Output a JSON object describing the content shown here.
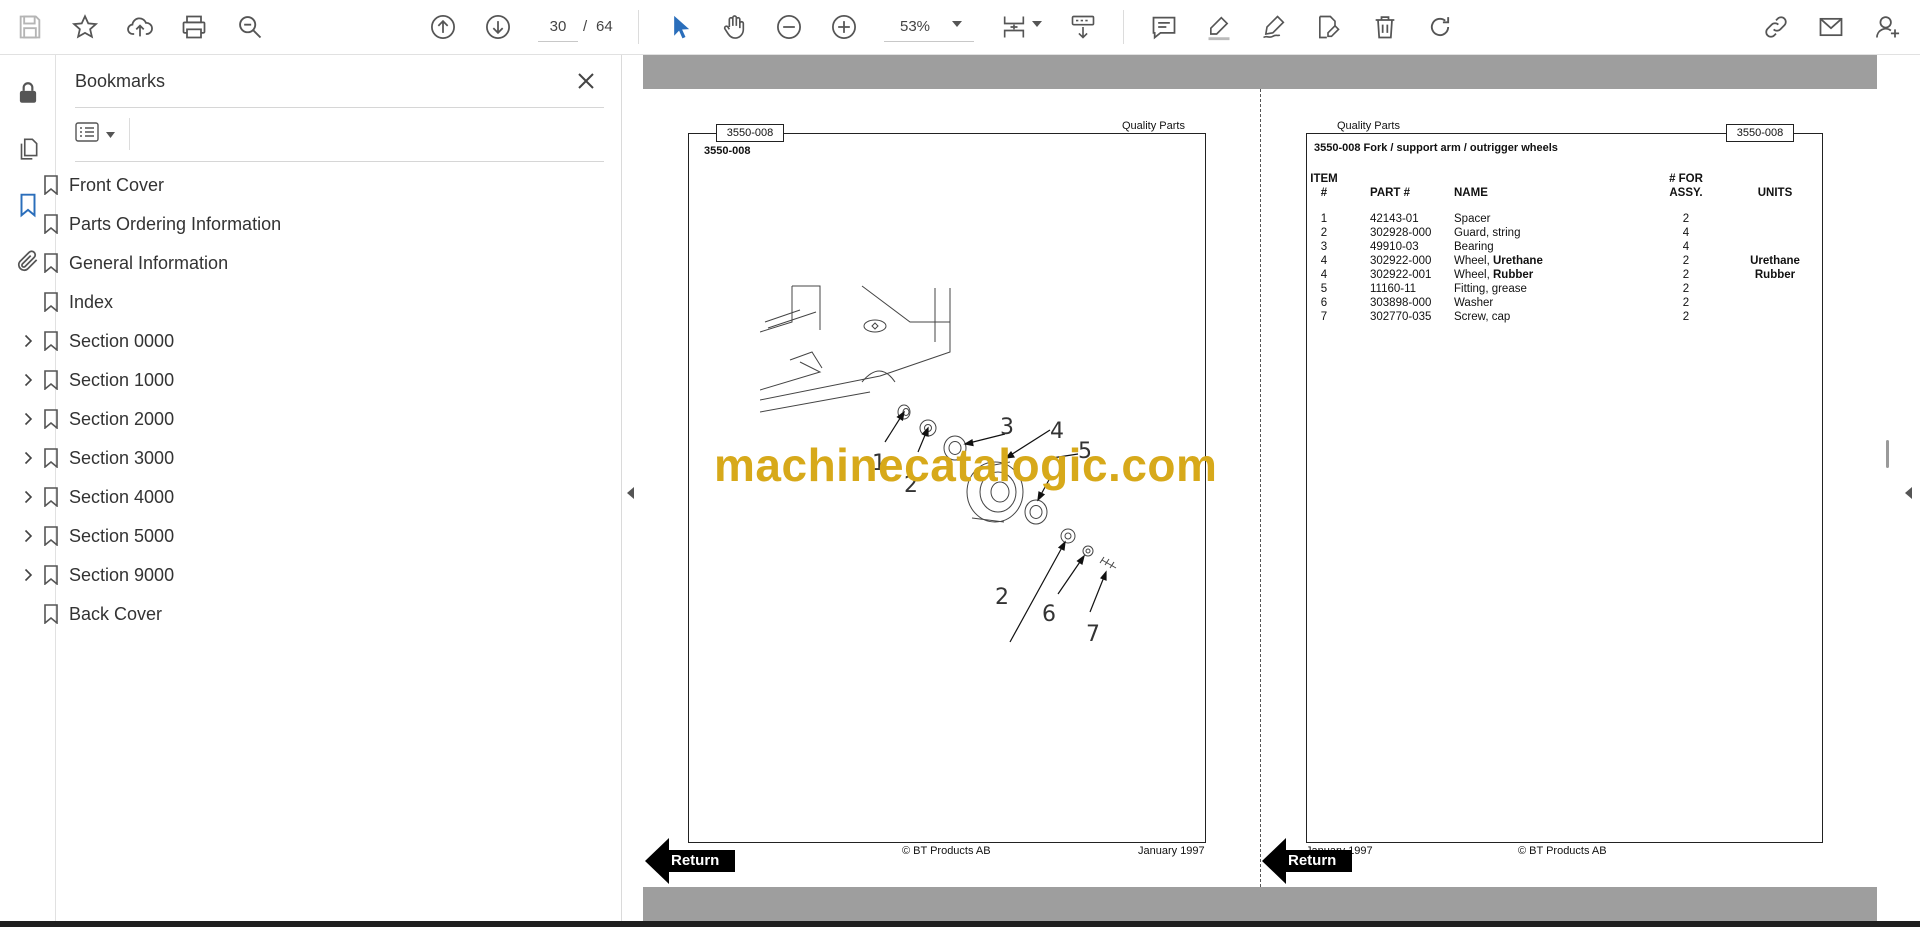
{
  "toolbar": {
    "page_current": "30",
    "page_separator": "/",
    "page_total": "64",
    "zoom": "53%"
  },
  "bookmarks": {
    "title": "Bookmarks",
    "items": [
      {
        "label": "Front Cover",
        "expandable": false
      },
      {
        "label": "Parts Ordering Information",
        "expandable": false
      },
      {
        "label": "General Information",
        "expandable": false
      },
      {
        "label": "Index",
        "expandable": false
      },
      {
        "label": "Section 0000",
        "expandable": true
      },
      {
        "label": "Section 1000",
        "expandable": true
      },
      {
        "label": "Section 2000",
        "expandable": true
      },
      {
        "label": "Section 3000",
        "expandable": true
      },
      {
        "label": "Section 4000",
        "expandable": true
      },
      {
        "label": "Section 5000",
        "expandable": true
      },
      {
        "label": "Section 9000",
        "expandable": true
      },
      {
        "label": "Back Cover",
        "expandable": false
      }
    ]
  },
  "colors": {
    "accent": "#2a6ebb",
    "watermark": "#d7a91a",
    "page_gutter": "#9e9e9e"
  },
  "left_page": {
    "tab": "3550-008",
    "header": "Quality Parts",
    "code": "3550-008",
    "callouts": [
      "1",
      "2",
      "3",
      "4",
      "5",
      "2",
      "6",
      "7"
    ],
    "footer_copyright": "© BT Products AB",
    "footer_date": "January 1997",
    "return_label": "Return"
  },
  "right_page": {
    "tab": "3550-008",
    "header": "Quality Parts",
    "title": "3550-008 Fork / support arm / outrigger wheels",
    "columns": {
      "item_line1": "ITEM",
      "item_line2": "#",
      "part": "PART #",
      "name": "NAME",
      "qty_line1": "# FOR",
      "qty_line2": "ASSY.",
      "units": "UNITS"
    },
    "rows": [
      {
        "item": "1",
        "part": "42143-01",
        "name": "Spacer",
        "name_bold": "",
        "qty": "2",
        "unit": ""
      },
      {
        "item": "2",
        "part": "302928-000",
        "name": "Guard, string",
        "name_bold": "",
        "qty": "4",
        "unit": ""
      },
      {
        "item": "3",
        "part": "49910-03",
        "name": "Bearing",
        "name_bold": "",
        "qty": "4",
        "unit": ""
      },
      {
        "item": "4",
        "part": "302922-000",
        "name": "Wheel, ",
        "name_bold": "Urethane",
        "qty": "2",
        "unit": "Urethane"
      },
      {
        "item": "4",
        "part": "302922-001",
        "name": "Wheel, ",
        "name_bold": "Rubber",
        "qty": "2",
        "unit": "Rubber"
      },
      {
        "item": "5",
        "part": "11160-11",
        "name": "Fitting, grease",
        "name_bold": "",
        "qty": "2",
        "unit": ""
      },
      {
        "item": "6",
        "part": "303898-000",
        "name": "Washer",
        "name_bold": "",
        "qty": "2",
        "unit": ""
      },
      {
        "item": "7",
        "part": "302770-035",
        "name": "Screw, cap",
        "name_bold": "",
        "qty": "2",
        "unit": ""
      }
    ],
    "footer_date": "January 1997",
    "footer_copyright": "© BT Products AB",
    "return_label": "Return"
  },
  "watermark": "machinecatalogic.com"
}
